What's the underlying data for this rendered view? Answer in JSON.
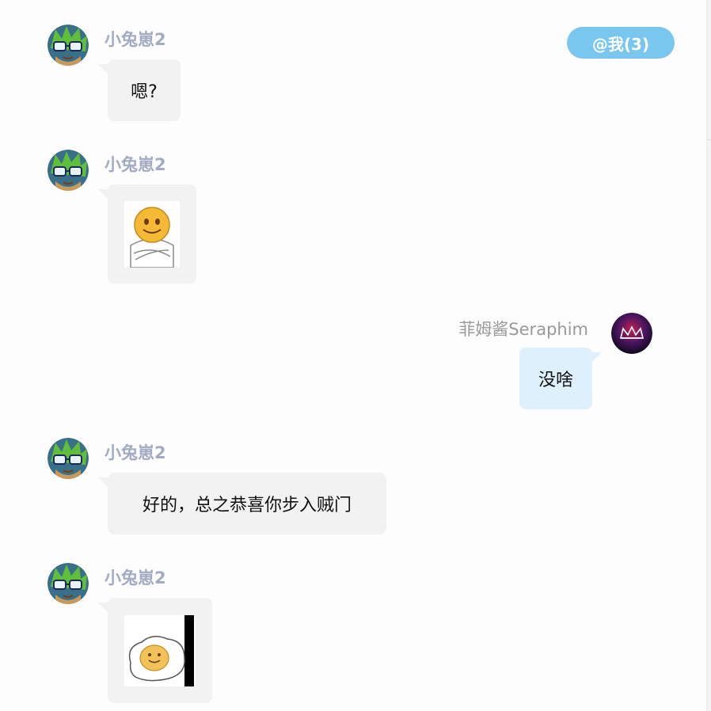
{
  "mention_indicator": {
    "label": "@我(3)"
  },
  "messages": [
    {
      "sender": "小兔崽2",
      "avatar_icon": "anime-avatar-icon",
      "side": "left",
      "type": "text",
      "text": "嗯?"
    },
    {
      "sender": "小兔崽2",
      "avatar_icon": "anime-avatar-icon",
      "side": "left",
      "type": "sticker",
      "sticker_icon": "arms-crossed-smiley-sticker-icon"
    },
    {
      "sender": "菲姆酱Seraphim",
      "avatar_icon": "crown-avatar-icon",
      "side": "right",
      "type": "text",
      "text": "没啥"
    },
    {
      "sender": "小兔崽2",
      "avatar_icon": "anime-avatar-icon",
      "side": "left",
      "type": "text",
      "text": "好的，总之恭喜你步入贼门"
    },
    {
      "sender": "小兔崽2",
      "avatar_icon": "anime-avatar-icon",
      "side": "left",
      "type": "sticker",
      "sticker_icon": "fried-egg-smiley-sticker-icon"
    }
  ],
  "colors": {
    "mention_bg": "#79c6ef",
    "bubble_other": "#f2f2f2",
    "bubble_self": "#dff0fd",
    "sender_other": "#a3abc2",
    "sender_self": "#9a9a9a"
  }
}
